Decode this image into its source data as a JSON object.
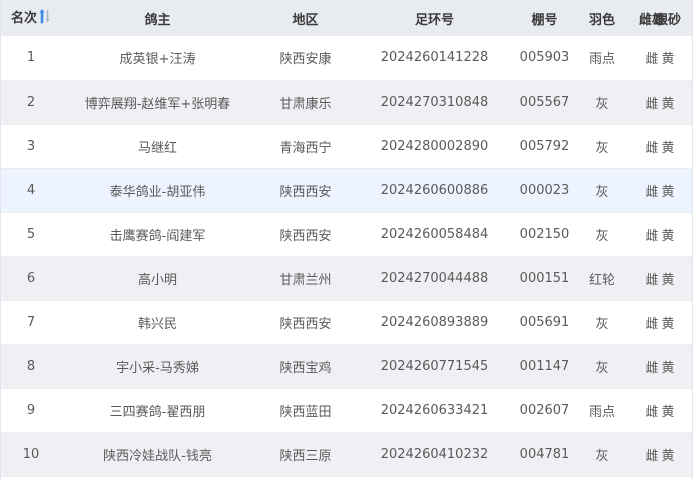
{
  "table": {
    "headers": {
      "rank": "名次",
      "owner": "鸽主",
      "area": "地区",
      "ring": "足环号",
      "shed": "棚号",
      "color": "羽色",
      "sex": "雌雄",
      "eye": "眼砂"
    },
    "sort_icon": "sort-ascending-icon",
    "accent_color": "#3a8ee6",
    "rows": [
      {
        "rank": "1",
        "owner": "成英银+汪涛",
        "area": "陕西安康",
        "ring": "2024260141228",
        "shed": "005903",
        "color": "雨点",
        "sex": "雌",
        "eye": "黄"
      },
      {
        "rank": "2",
        "owner": "博弈展翔-赵维军+张明春",
        "area": "甘肃康乐",
        "ring": "2024270310848",
        "shed": "005567",
        "color": "灰",
        "sex": "雌",
        "eye": "黄"
      },
      {
        "rank": "3",
        "owner": "马继红",
        "area": "青海西宁",
        "ring": "2024280002890",
        "shed": "005792",
        "color": "灰",
        "sex": "雌",
        "eye": "黄"
      },
      {
        "rank": "4",
        "owner": "泰华鸽业-胡亚伟",
        "area": "陕西西安",
        "ring": "2024260600886",
        "shed": "000023",
        "color": "灰",
        "sex": "雌",
        "eye": "黄"
      },
      {
        "rank": "5",
        "owner": "击鹰赛鸽-阎建军",
        "area": "陕西西安",
        "ring": "2024260058484",
        "shed": "002150",
        "color": "灰",
        "sex": "雌",
        "eye": "黄"
      },
      {
        "rank": "6",
        "owner": "高小明",
        "area": "甘肃兰州",
        "ring": "2024270044488",
        "shed": "000151",
        "color": "红轮",
        "sex": "雌",
        "eye": "黄"
      },
      {
        "rank": "7",
        "owner": "韩兴民",
        "area": "陕西西安",
        "ring": "2024260893889",
        "shed": "005691",
        "color": "灰",
        "sex": "雌",
        "eye": "黄"
      },
      {
        "rank": "8",
        "owner": "宇小采-马秀娣",
        "area": "陕西宝鸡",
        "ring": "2024260771545",
        "shed": "001147",
        "color": "灰",
        "sex": "雌",
        "eye": "黄"
      },
      {
        "rank": "9",
        "owner": "三四赛鸽-翟西朋",
        "area": "陕西蓝田",
        "ring": "2024260633421",
        "shed": "002607",
        "color": "雨点",
        "sex": "雌",
        "eye": "黄"
      },
      {
        "rank": "10",
        "owner": "陕西冷娃战队-钱亮",
        "area": "陕西三原",
        "ring": "2024260410232",
        "shed": "004781",
        "color": "灰",
        "sex": "雌",
        "eye": "黄"
      }
    ]
  }
}
